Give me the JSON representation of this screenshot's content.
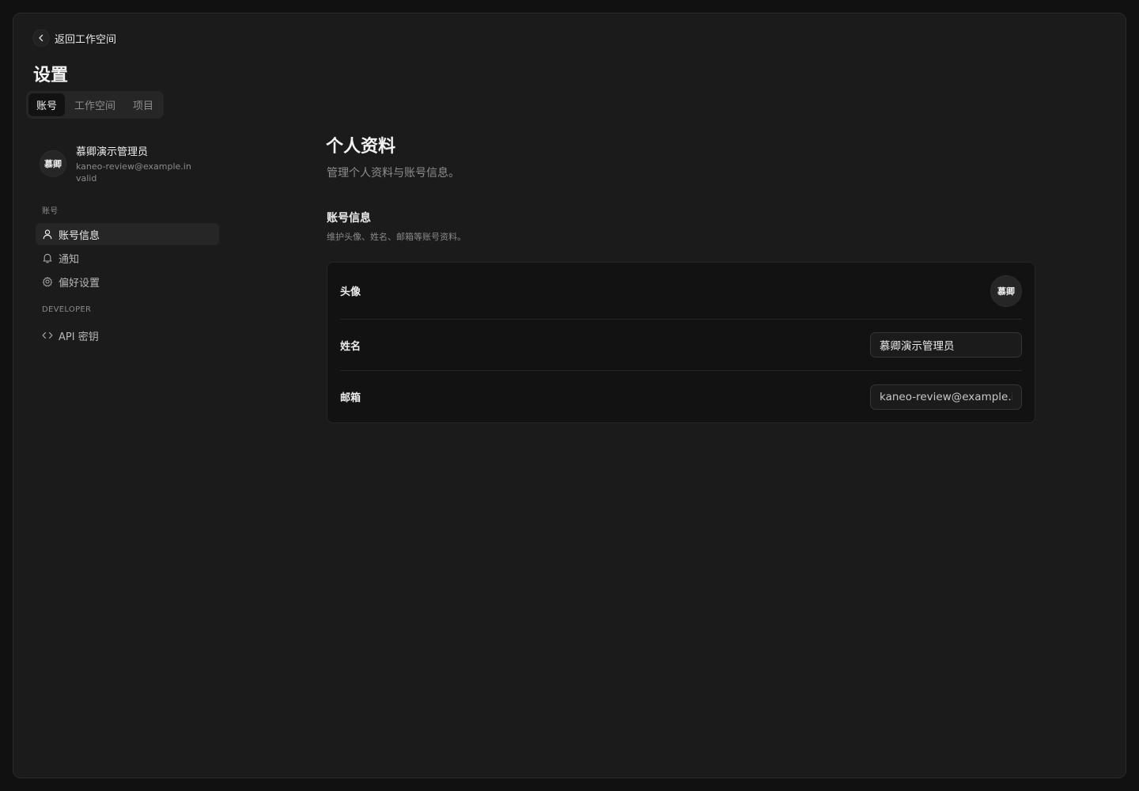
{
  "header": {
    "back_label": "返回工作空间",
    "title": "设置",
    "tabs": [
      {
        "label": "账号",
        "active": true
      },
      {
        "label": "工作空间",
        "active": false
      },
      {
        "label": "项目",
        "active": false
      }
    ]
  },
  "user": {
    "avatar_text": "慕卿",
    "name": "慕卿演示管理员",
    "email": "kaneo-review@example.invalid"
  },
  "sidebar": {
    "section_account": "账号",
    "section_developer": "DEVELOPER",
    "items": [
      {
        "label": "账号信息",
        "icon": "user-icon",
        "active": true
      },
      {
        "label": "通知",
        "icon": "bell-icon",
        "active": false
      },
      {
        "label": "偏好设置",
        "icon": "gear-icon",
        "active": false
      },
      {
        "label": "API 密钥",
        "icon": "code-icon",
        "active": false
      }
    ]
  },
  "main": {
    "title": "个人资料",
    "subtitle": "管理个人资料与账号信息。",
    "section": {
      "title": "账号信息",
      "description": "维护头像、姓名、邮箱等账号资料。",
      "rows": {
        "avatar_label": "头像",
        "avatar_text": "慕卿",
        "name_label": "姓名",
        "name_value": "慕卿演示管理员",
        "email_label": "邮箱",
        "email_value": "kaneo-review@example.invalid"
      }
    }
  }
}
